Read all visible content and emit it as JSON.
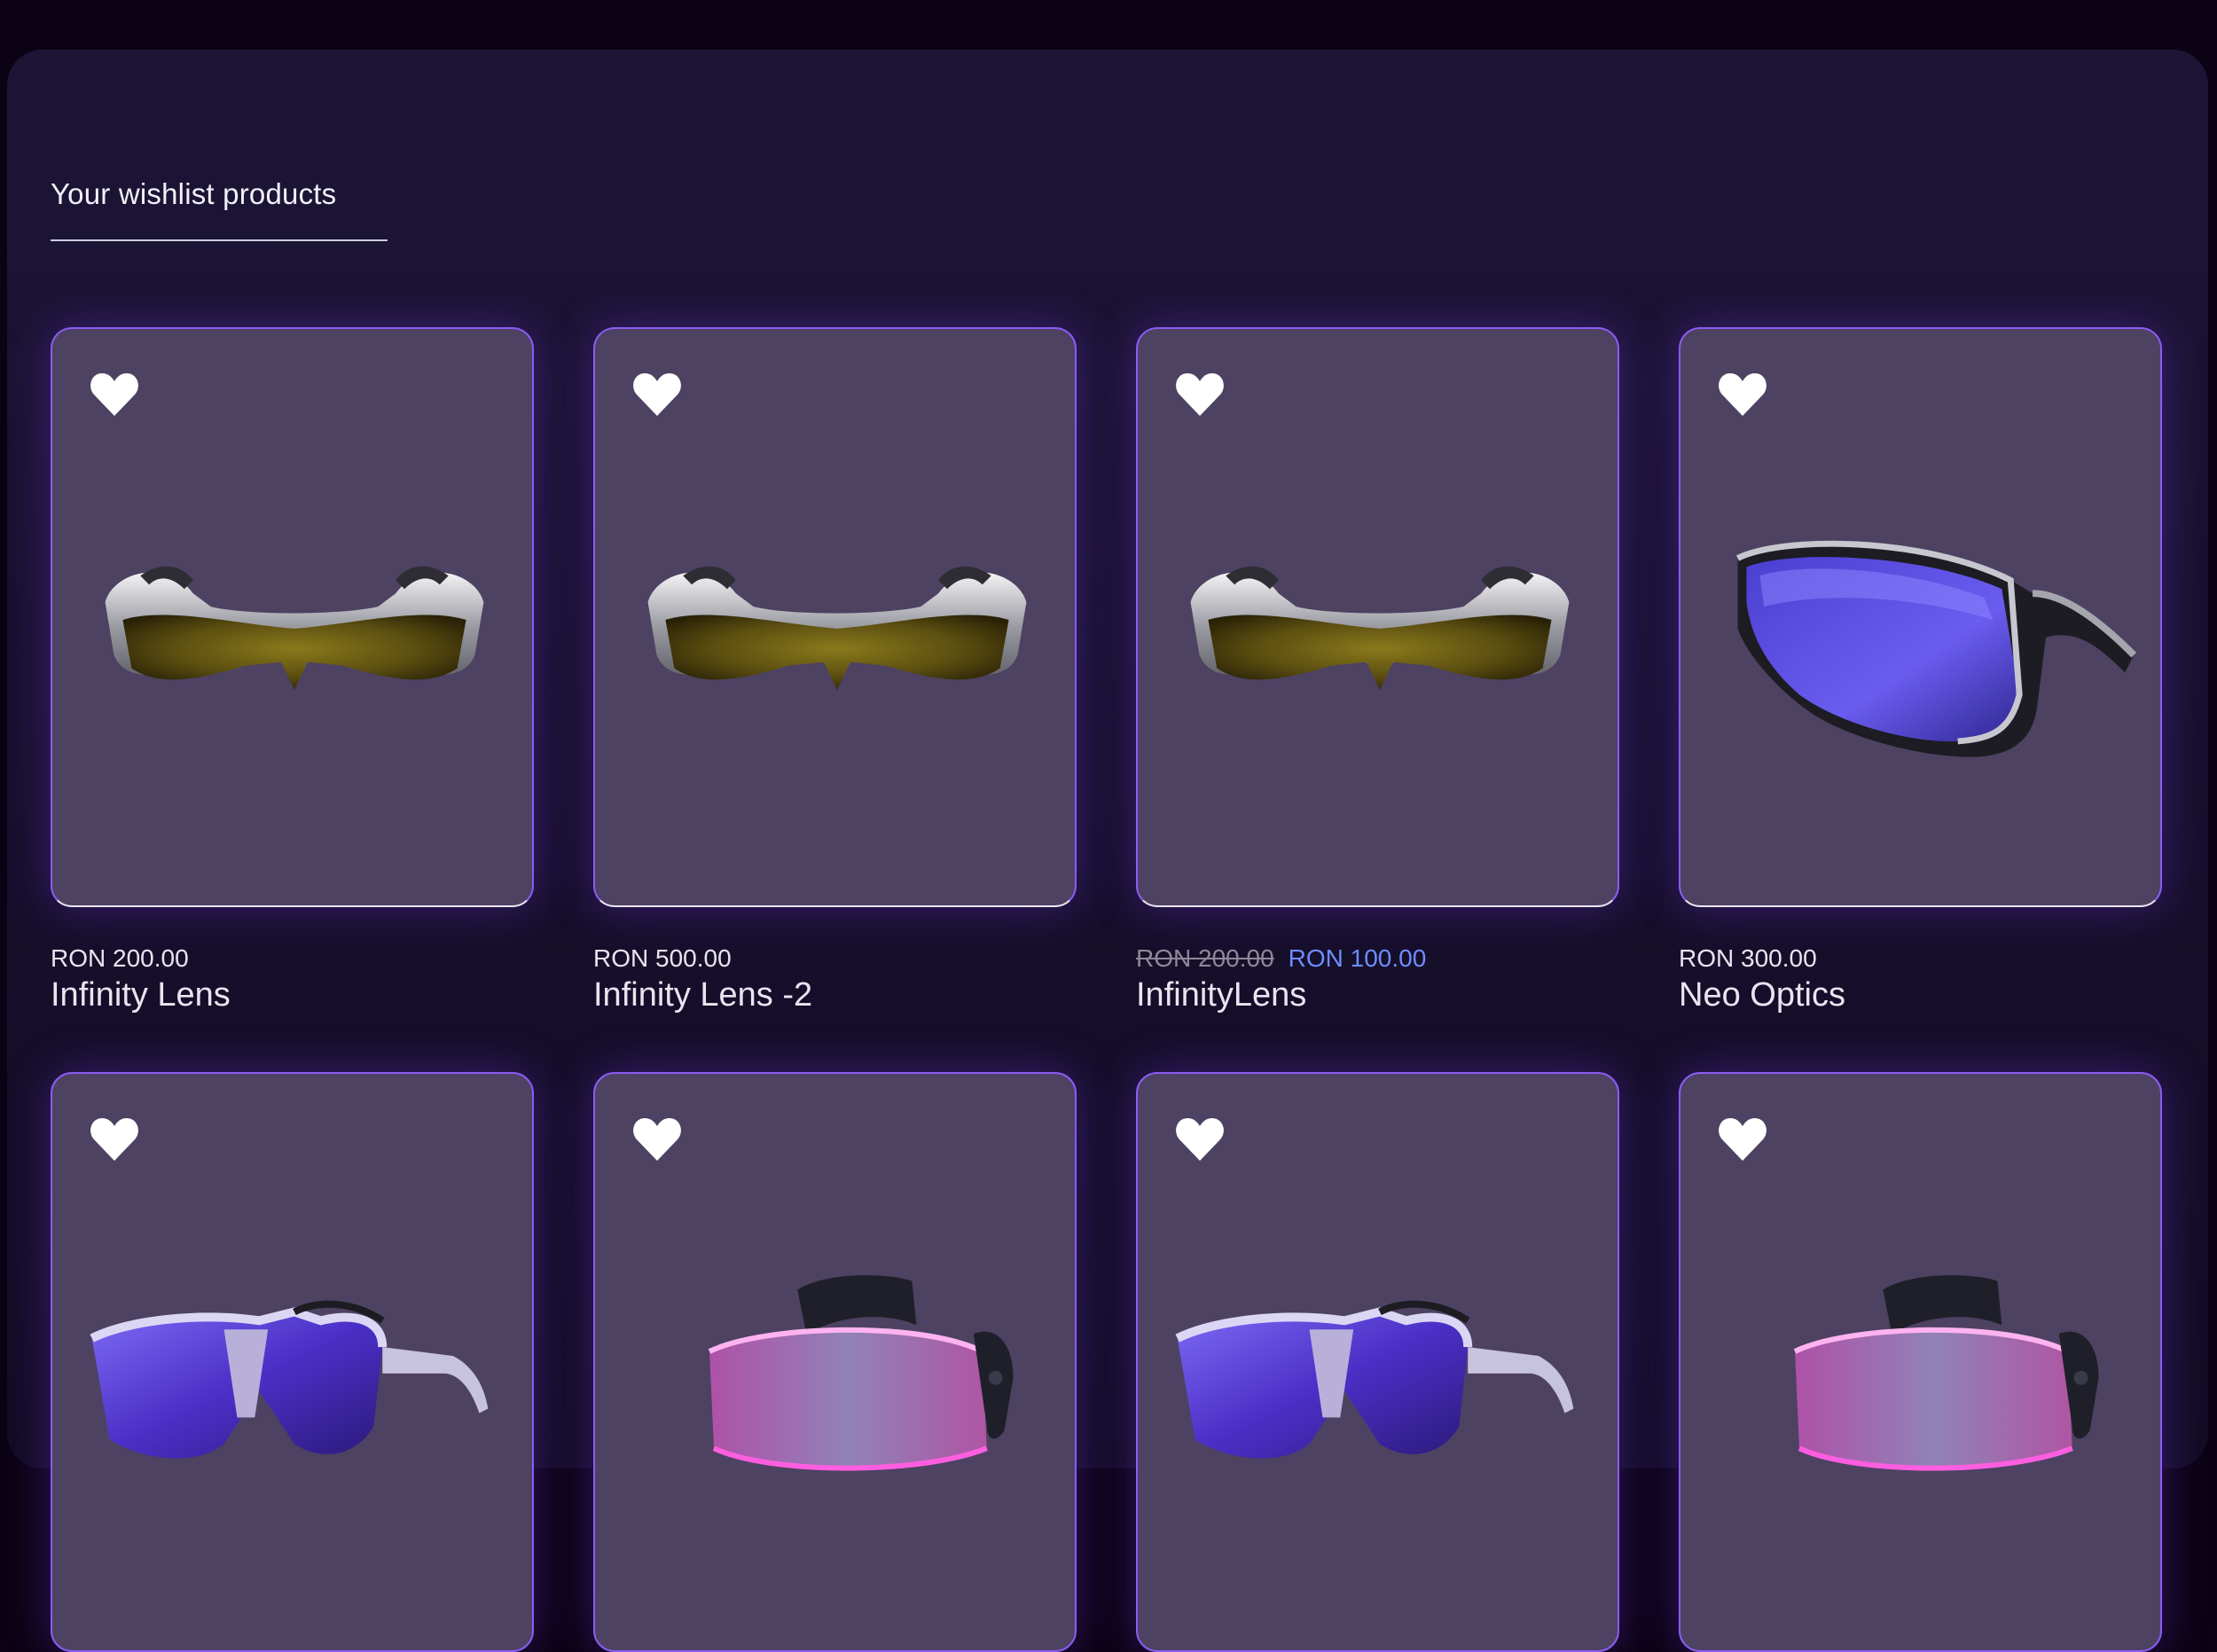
{
  "page": {
    "section_title": "Your wishlist products"
  },
  "colors": {
    "page_background": "#0b0314",
    "panel_background": "#1a1330",
    "card_background": "#4d4262",
    "card_border": "#8b5cf6",
    "sale_price": "#6d8cff"
  },
  "products": [
    {
      "name": "Infinity Lens",
      "price": "RON 200.00",
      "old_price": "",
      "sale_price": "",
      "wishlisted": true,
      "icon": "heart-icon",
      "image": "silver-shield-sunglasses-gold-lens"
    },
    {
      "name": "Infinity Lens -2",
      "price": "RON 500.00",
      "old_price": "",
      "sale_price": "",
      "wishlisted": true,
      "icon": "heart-icon",
      "image": "silver-shield-sunglasses-gold-lens"
    },
    {
      "name": "InfinityLens",
      "price": "",
      "old_price": "RON 200.00",
      "sale_price": "RON 100.00",
      "wishlisted": true,
      "icon": "heart-icon",
      "image": "silver-shield-sunglasses-gold-lens"
    },
    {
      "name": "Neo Optics",
      "price": "RON 300.00",
      "old_price": "",
      "sale_price": "",
      "wishlisted": true,
      "icon": "heart-icon",
      "image": "aviator-sunglasses-blue-lens"
    },
    {
      "wishlisted": true,
      "icon": "heart-icon",
      "image": "futuristic-sunglasses-purple-lens"
    },
    {
      "wishlisted": true,
      "icon": "heart-icon",
      "image": "led-visor-glasses-pink"
    },
    {
      "wishlisted": true,
      "icon": "heart-icon",
      "image": "futuristic-sunglasses-purple-lens"
    },
    {
      "wishlisted": true,
      "icon": "heart-icon",
      "image": "led-visor-glasses-pink"
    }
  ]
}
